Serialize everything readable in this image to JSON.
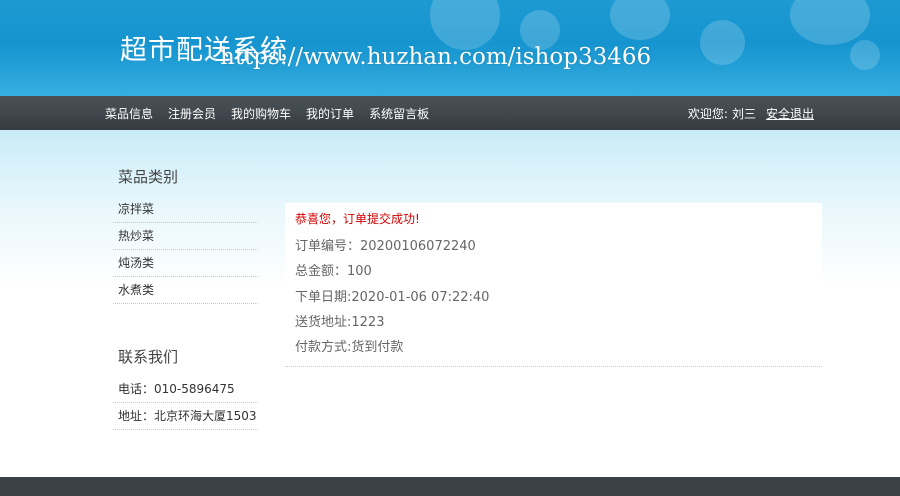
{
  "header": {
    "title": "超市配送系统",
    "watermark": "https://www.huzhan.com/ishop33466"
  },
  "nav": {
    "items": [
      {
        "label": "菜品信息"
      },
      {
        "label": "注册会员"
      },
      {
        "label": "我的购物车"
      },
      {
        "label": "我的订单"
      },
      {
        "label": "系统留言板"
      }
    ],
    "welcome": "欢迎您:",
    "username": "刘三",
    "logout": "安全退出"
  },
  "sidebar": {
    "categories_title": "菜品类别",
    "categories": [
      {
        "label": "凉拌菜"
      },
      {
        "label": "热炒菜"
      },
      {
        "label": "炖汤类"
      },
      {
        "label": "水煮类"
      }
    ],
    "contact_title": "联系我们",
    "contact": {
      "phone": "电话：010-5896475",
      "address": "地址：北京环海大厦1503"
    }
  },
  "order": {
    "success_message": "恭喜您，订单提交成功!",
    "order_no": "订单编号：20200106072240",
    "total": "总金额：100",
    "order_date": "下单日期:2020-01-06 07:22:40",
    "address": "送货地址:1223",
    "payment": "付款方式:货到付款"
  },
  "colors": {
    "header_blue": "#1594cf",
    "nav_dark": "#3b4146",
    "success_red": "#d40000"
  }
}
